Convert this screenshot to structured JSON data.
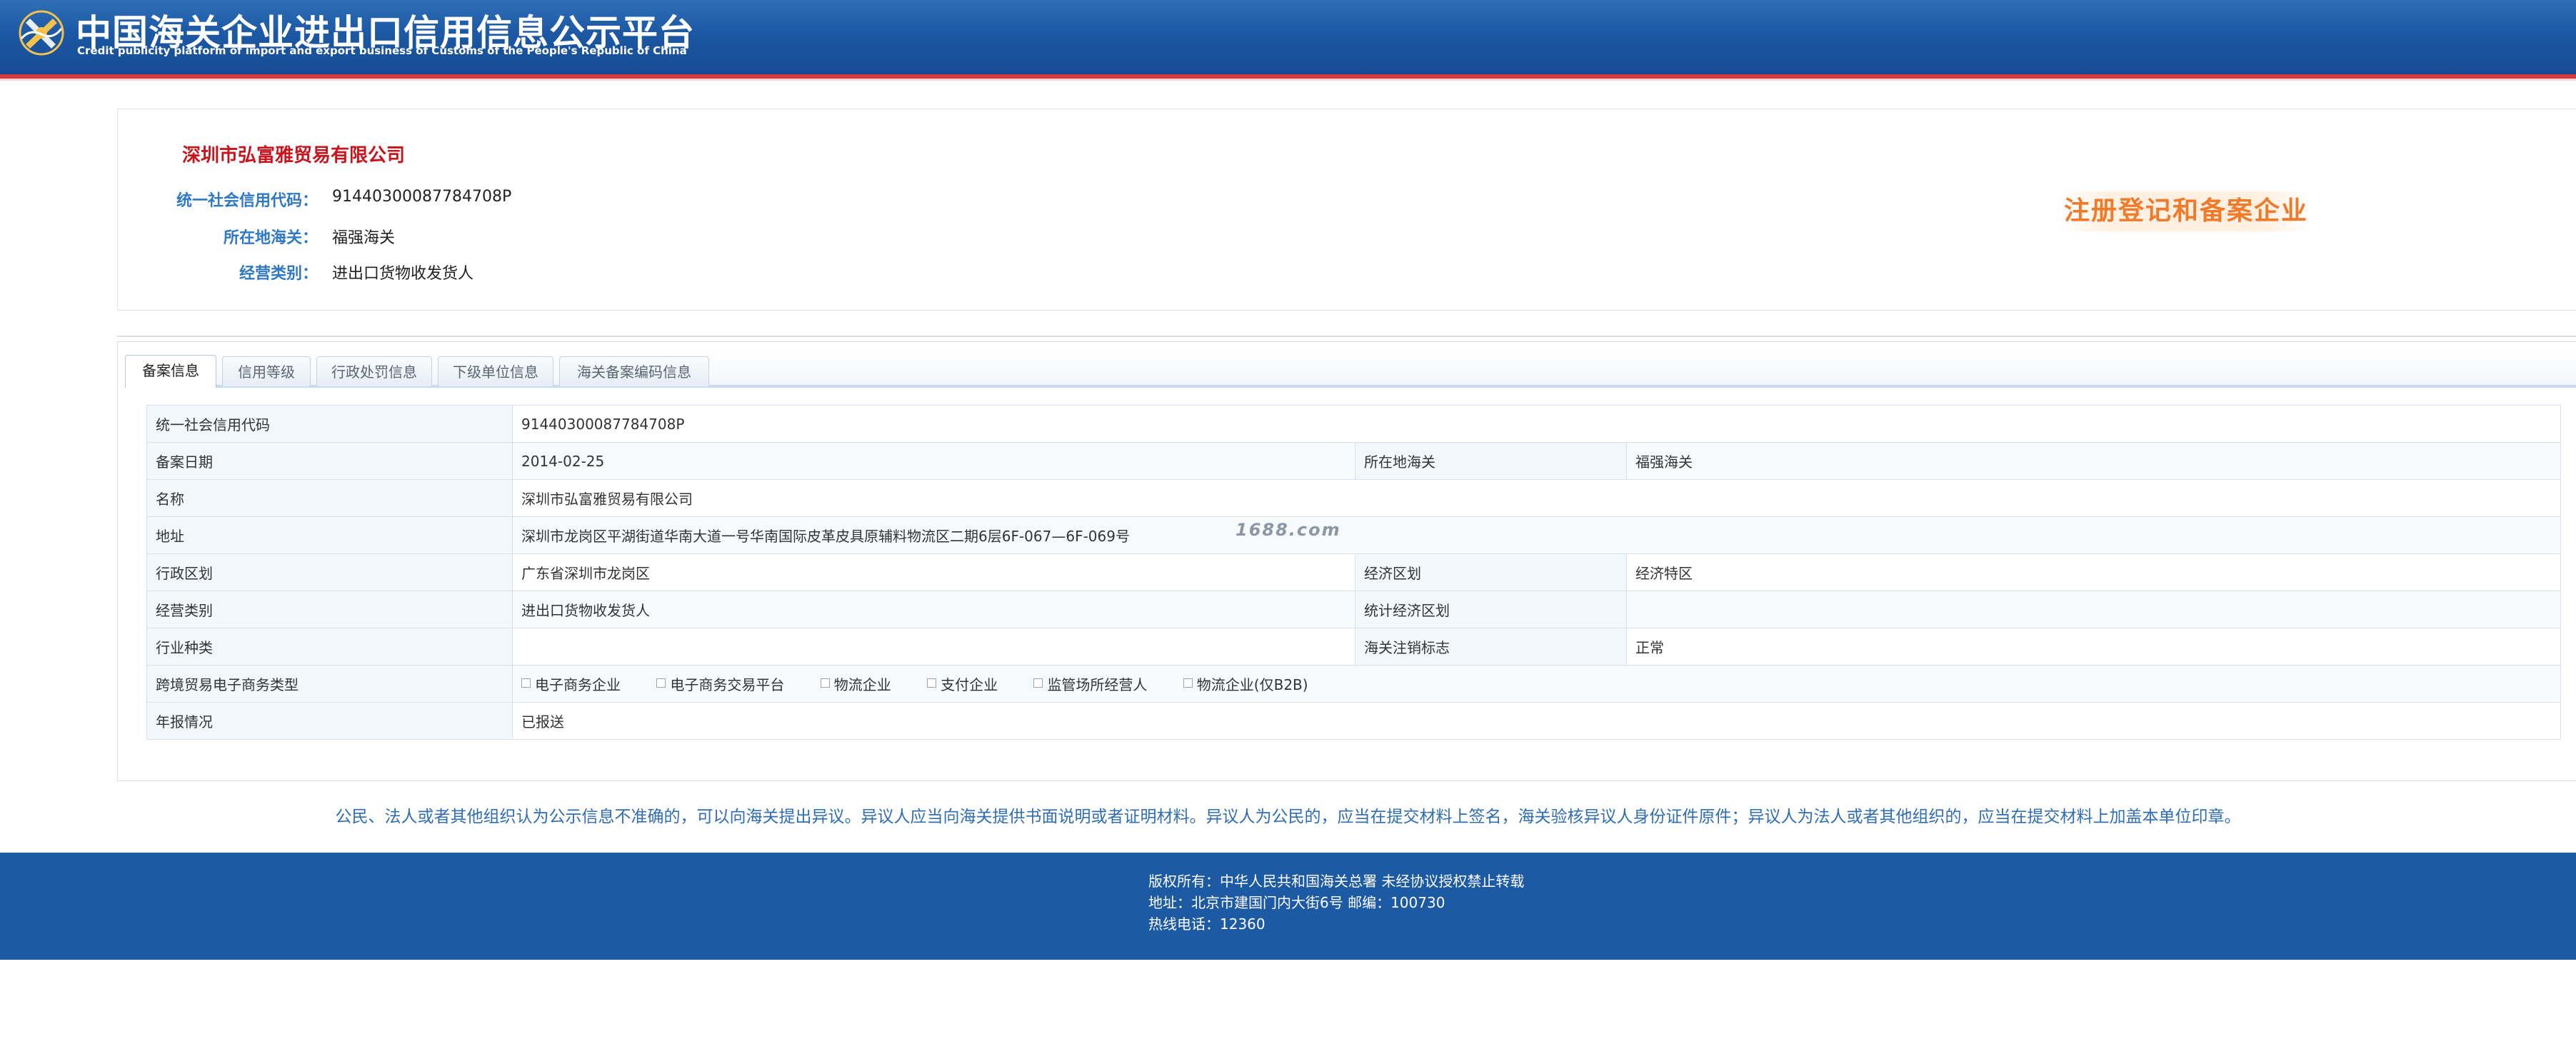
{
  "header": {
    "title": "中国海关企业进出口信用信息公示平台",
    "subtitle": "Credit publicity platform of import and export business of Customs of the People's Republic of China"
  },
  "company": {
    "name": "深圳市弘富雅贸易有限公司",
    "fields": [
      {
        "label": "统一社会信用代码：",
        "value": "91440300087784708P"
      },
      {
        "label": "所在地海关：",
        "value": "福强海关"
      },
      {
        "label": "经营类别：",
        "value": "进出口货物收发货人"
      }
    ],
    "status_stamp": "注册登记和备案企业"
  },
  "tabs": [
    {
      "label": "备案信息",
      "active": true
    },
    {
      "label": "信用等级",
      "active": false
    },
    {
      "label": "行政处罚信息",
      "active": false
    },
    {
      "label": "下级单位信息",
      "active": false
    },
    {
      "label": "海关备案编码信息",
      "active": false
    }
  ],
  "table": {
    "credit_code_label": "统一社会信用代码",
    "credit_code_value": "91440300087784708P",
    "record_date_label": "备案日期",
    "record_date_value": "2014-02-25",
    "customs_label": "所在地海关",
    "customs_value": "福强海关",
    "name_label": "名称",
    "name_value": "深圳市弘富雅贸易有限公司",
    "address_label": "地址",
    "address_value": "深圳市龙岗区平湖街道华南大道一号华南国际皮革皮具原辅料物流区二期6层6F-067—6F-069号",
    "admin_region_label": "行政区划",
    "admin_region_value": "广东省深圳市龙岗区",
    "econ_region_label": "经济区划",
    "econ_region_value": "经济特区",
    "biz_category_label": "经营类别",
    "biz_category_value": "进出口货物收发货人",
    "stat_region_label": "统计经济区划",
    "stat_region_value": "",
    "industry_label": "行业种类",
    "industry_value": "",
    "cancel_flag_label": "海关注销标志",
    "cancel_flag_value": "正常",
    "ecommerce_label": "跨境贸易电子商务类型",
    "ecommerce_options": [
      "电子商务企业",
      "电子商务交易平台",
      "物流企业",
      "支付企业",
      "监管场所经营人",
      "物流企业(仅B2B)"
    ],
    "annual_report_label": "年报情况",
    "annual_report_value": "已报送"
  },
  "watermark": "1688.com",
  "notice": "公民、法人或者其他组织认为公示信息不准确的，可以向海关提出异议。异议人应当向海关提供书面说明或者证明材料。异议人为公民的，应当在提交材料上签名，海关验核异议人身份证件原件；异议人为法人或者其他组织的，应当在提交材料上加盖本单位印章。",
  "footer": {
    "copyright": "版权所有：中华人民共和国海关总署   未经协议授权禁止转载",
    "address": "地址：北京市建国门内大街6号 邮编：100730",
    "hotline": "热线电话：12360"
  },
  "colors": {
    "header_blue": "#1c58a4",
    "accent_red": "#c8141c",
    "label_blue": "#2f78c6",
    "stamp_orange": "#ef7a2a",
    "footer_blue": "#1c5aa4"
  }
}
